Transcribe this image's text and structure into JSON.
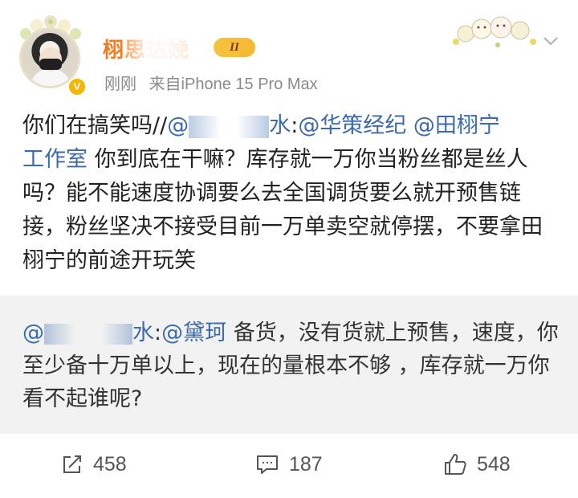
{
  "post": {
    "username": "栩思达娩",
    "rank_badge": "II",
    "time": "刚刚",
    "source": "来自iPhone 15 Pro Max",
    "text": {
      "p1": "你们在搞笑吗//",
      "m1": "@",
      "m1b": "水",
      "p2": ":",
      "m2": "@华策经纪",
      "p3": " ",
      "m3a": "@田栩宁",
      "m3b": "工作室",
      "p4": " 你到底在干嘛？库存就一万你当粉丝都是丝人吗？能不能速度协调要么去全国调货要么就开预售链接，粉丝坚决不接受目前一万单卖空就停摆，不要拿田栩宁的前途开玩笑"
    }
  },
  "repost": {
    "m1": "@",
    "m1b": "水",
    "p1": ":",
    "m2": "@黛珂",
    "p2": " 备货，没有货就上预售，速度，你至少备十万单以上，现在的量根本不够 ，库存就一万你看不起谁呢?"
  },
  "actions": {
    "repost_count": "458",
    "comment_count": "187",
    "like_count": "548"
  },
  "icons": {
    "repost": "share-icon",
    "comment": "comment-icon",
    "like": "thumbs-up-icon",
    "chevron": "chevron-down-icon",
    "verified": "verified-badge-icon"
  },
  "colors": {
    "link": "#3a6ab0",
    "username": "#f37b1d",
    "badge": "#f7b500"
  }
}
